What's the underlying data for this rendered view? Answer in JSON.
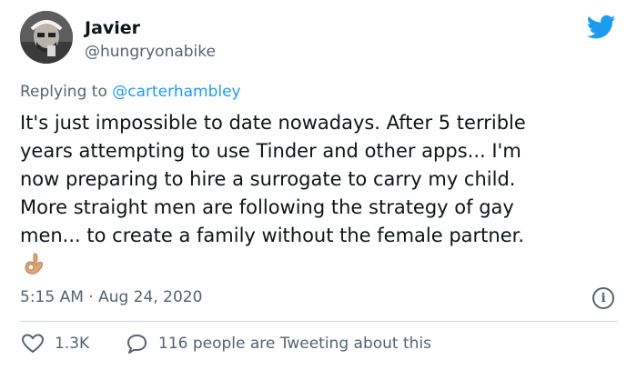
{
  "author": {
    "name": "Javier",
    "handle": "@hungryonabike",
    "avatar_icon": "avatar-photo"
  },
  "brand": {
    "icon": "twitter-bird-icon",
    "color": "#1d9bf0"
  },
  "reply": {
    "prefix": "Replying to",
    "mention": "@carterhambley"
  },
  "tweet": {
    "text": "It's just impossible to date nowadays. After 5 terrible\nyears attempting to use Tinder and other apps... I'm\nnow preparing to hire a surrogate to carry my child.\nMore straight men are following the strategy of gay\nmen... to create a family without the female partner.",
    "emoji": "ok-hand-emoji"
  },
  "meta": {
    "timestamp": "5:15 AM · Aug 24, 2020",
    "info_glyph": "i"
  },
  "actions": {
    "like_count": "1.3K",
    "comment_label": "116 people are Tweeting about this"
  },
  "colors": {
    "text": "#0f1419",
    "secondary": "#536471",
    "link": "#1d9bf0",
    "divider": "#cfd9de"
  }
}
